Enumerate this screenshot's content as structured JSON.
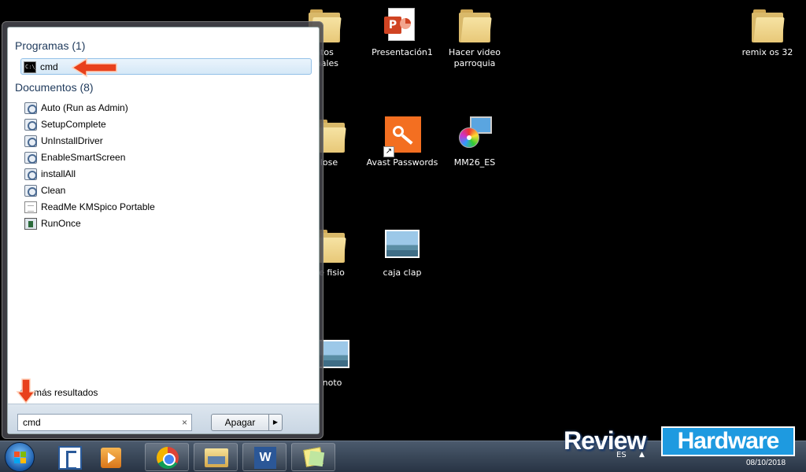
{
  "desktop": {
    "icons": [
      {
        "label": "ntos\nonales"
      },
      {
        "label": "Presentación1"
      },
      {
        "label": "Hacer video parroquia"
      },
      {
        "label": "remix os 32"
      },
      {
        "label": "lose"
      },
      {
        "label": "Avast Passwords"
      },
      {
        "label": "MM26_ES"
      },
      {
        "label": "de fisio"
      },
      {
        "label": "caja clap"
      },
      {
        "label": "noto"
      }
    ]
  },
  "start_menu": {
    "programs_heading": "Programas (1)",
    "programs": [
      {
        "label": "cmd",
        "icon": "cmd-icon"
      }
    ],
    "documents_heading": "Documentos (8)",
    "documents": [
      {
        "label": "Auto (Run as Admin)",
        "icon": "script-icon"
      },
      {
        "label": "SetupComplete",
        "icon": "script-icon"
      },
      {
        "label": "UnInstallDriver",
        "icon": "script-icon"
      },
      {
        "label": "EnableSmartScreen",
        "icon": "script-icon"
      },
      {
        "label": "installAll",
        "icon": "script-icon"
      },
      {
        "label": "Clean",
        "icon": "script-icon"
      },
      {
        "label": "ReadMe KMSpico Portable",
        "icon": "text-file-icon"
      },
      {
        "label": "RunOnce",
        "icon": "registry-icon"
      }
    ],
    "more_results": "más resultados",
    "search_value": "cmd",
    "clear_glyph": "×",
    "shutdown_label": "Apagar",
    "shutdown_arrow": "▶"
  },
  "taskbar": {
    "language": "ES",
    "tray_arrow": "▲",
    "clock_date": "08/10/2018"
  },
  "watermark": {
    "review": "Review",
    "hardware": "Hardware"
  },
  "colors": {
    "desktop": "#000000",
    "highlight": "#d5e8f7",
    "annotation_arrow": "#e8411c",
    "watermark_blue": "#1e9ae0"
  }
}
